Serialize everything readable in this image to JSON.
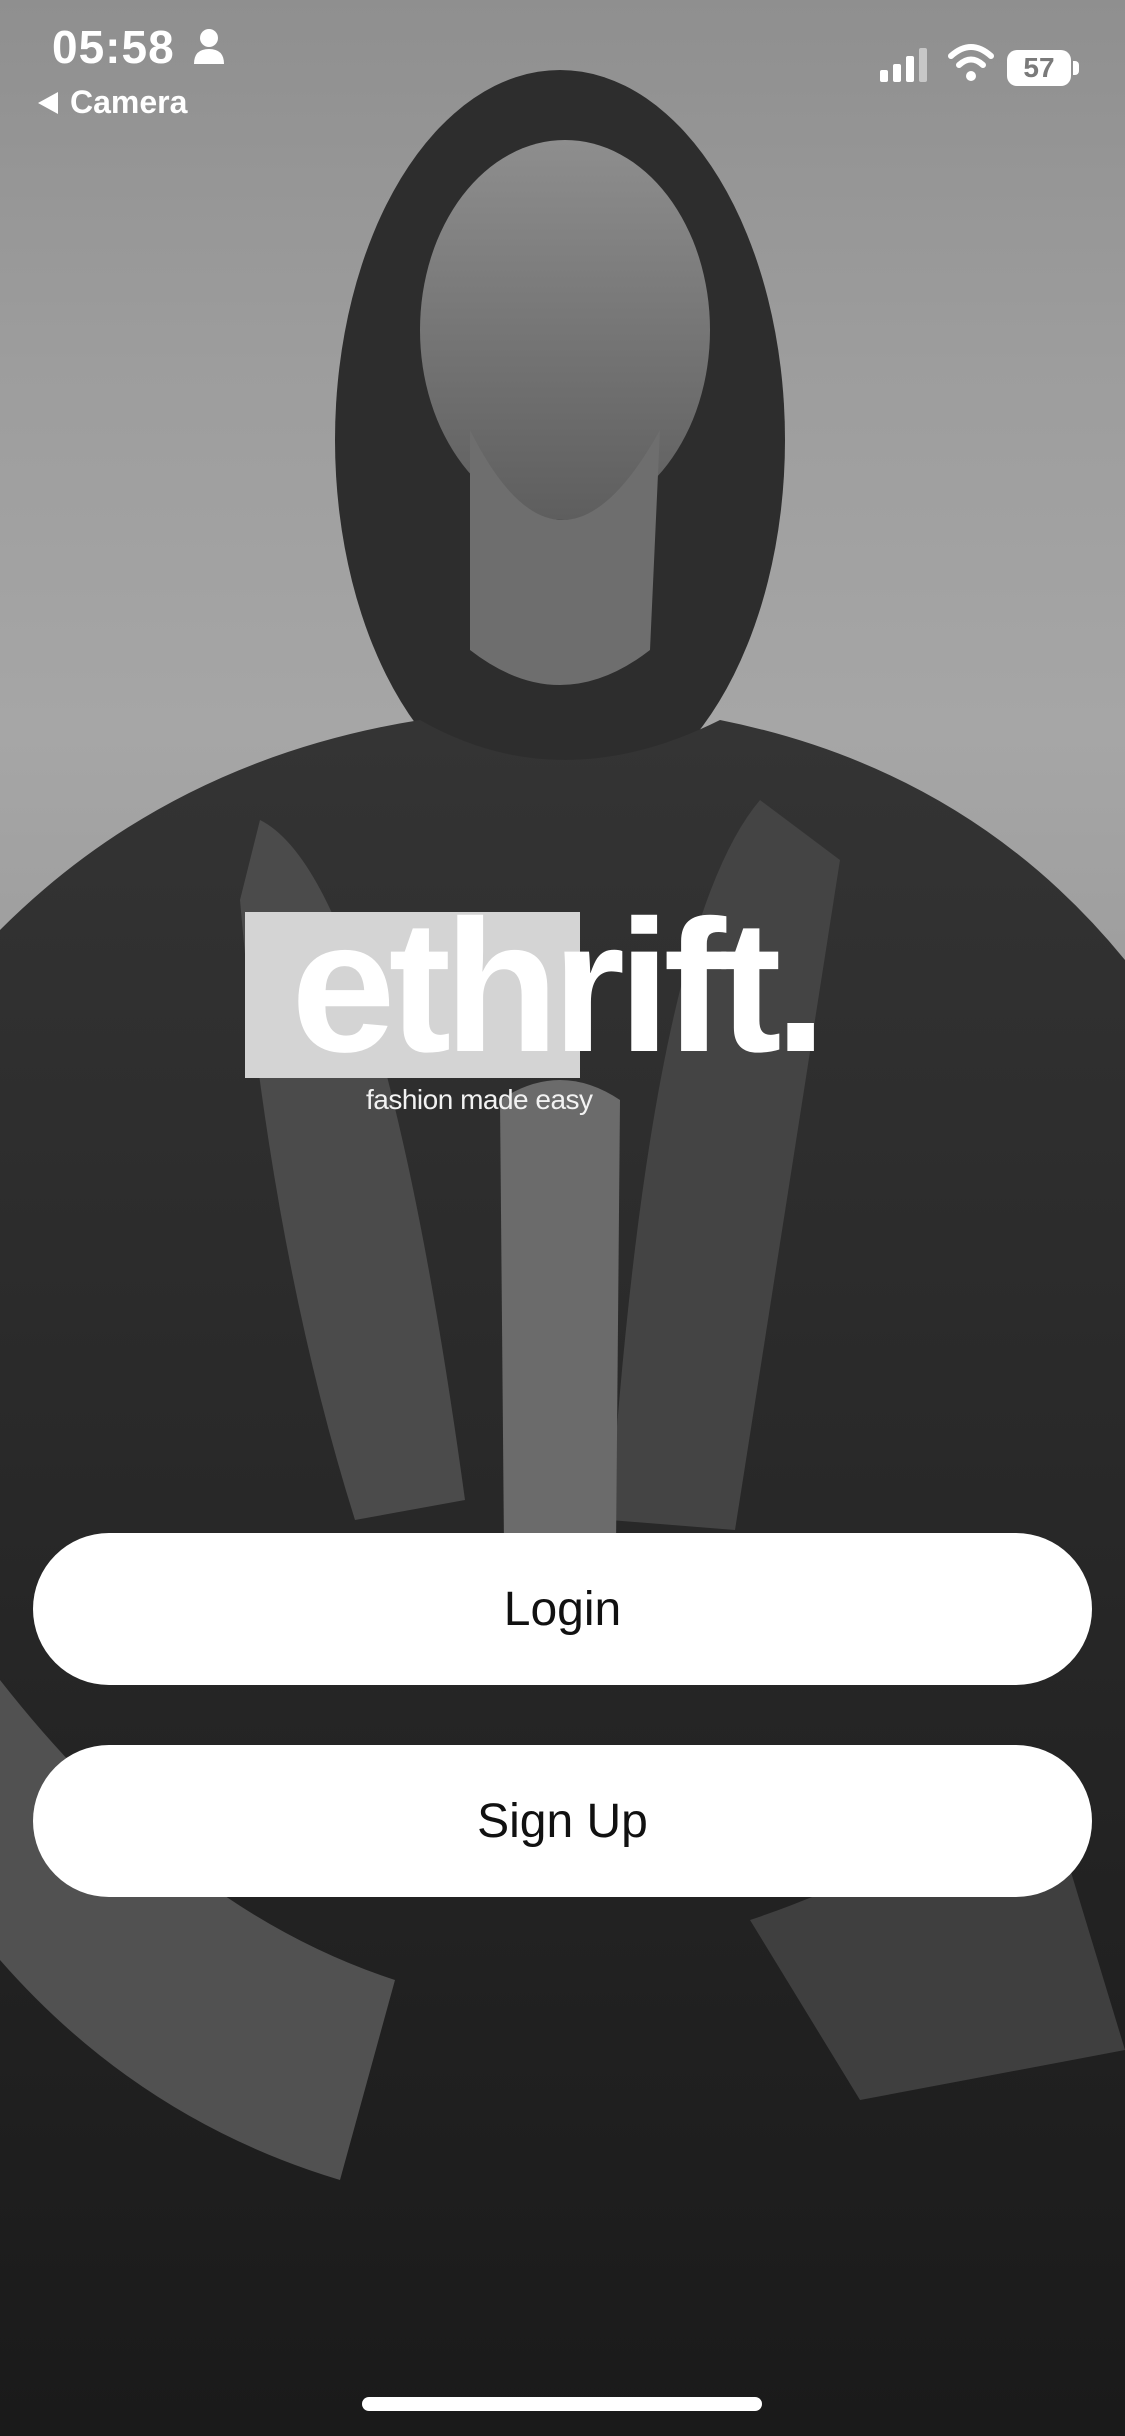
{
  "status_bar": {
    "time": "05:58",
    "back_label": "Camera",
    "battery_level": "57",
    "icons": [
      "person-icon",
      "signal-icon",
      "wifi-icon",
      "battery-icon"
    ]
  },
  "brand": {
    "name": "ethrift.",
    "tagline": "fashion made easy"
  },
  "actions": {
    "login_label": "Login",
    "signup_label": "Sign Up"
  },
  "colors": {
    "button_bg": "#ffffff",
    "button_text": "#111111",
    "brand_box": "#d4d4d4",
    "photo_tone": "#9a9a9a"
  }
}
